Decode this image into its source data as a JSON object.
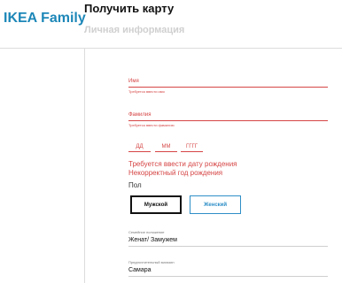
{
  "brand": "IKEA Family",
  "header": {
    "title": "Получить карту",
    "section": "Личная информация"
  },
  "form": {
    "first_name": {
      "label": "Имя",
      "error": "Требуется ввести имя"
    },
    "last_name": {
      "label": "Фамилия",
      "error": "Требуется ввести фамилию"
    },
    "birth_date": {
      "day": "ДД",
      "month": "ММ",
      "year": "ГГГГ",
      "errors": [
        "Требуется ввести дату рождения",
        "Некорректный год рождения"
      ]
    },
    "gender": {
      "label": "Пол",
      "male": "Мужской",
      "female": "Женский",
      "selected": "Мужской"
    },
    "marital_status": {
      "label": "Семейное положение",
      "value": "Женат/ Замужем"
    },
    "preferred_store": {
      "label": "Предпочтительный магазин",
      "value": "Самара"
    }
  },
  "colors": {
    "brand": "#1d87b8",
    "error": "#d64545",
    "accent": "#2f8fc7"
  }
}
